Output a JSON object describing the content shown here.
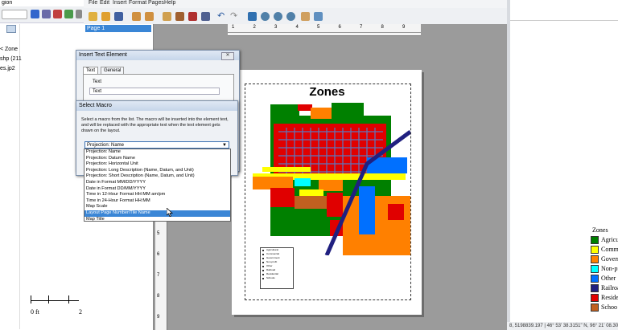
{
  "menu": [
    "File",
    "Edit",
    "Insert",
    "Format",
    "Pages",
    "Help"
  ],
  "left_partial": {
    "top_text": "gion",
    "tree": [
      "< Zone",
      "shp (211",
      "es.jp2"
    ],
    "scale": [
      "0 ft",
      "2"
    ]
  },
  "pages": {
    "items": [
      "Page 1"
    ]
  },
  "map": {
    "title": "Zones",
    "legend_items": [
      "Agricultural",
      "Commercial",
      "Government",
      "Non-profit",
      "Other",
      "Railroad",
      "Residential",
      "Schools"
    ]
  },
  "right_legend": {
    "title": "Zones",
    "items": [
      {
        "label": "Agricul",
        "color": "#008000"
      },
      {
        "label": "Comme",
        "color": "#ffff00"
      },
      {
        "label": "Govern",
        "color": "#ff8000"
      },
      {
        "label": "Non-pr",
        "color": "#00ffff"
      },
      {
        "label": "Other",
        "color": "#0070ff"
      },
      {
        "label": "Railroa",
        "color": "#202080"
      },
      {
        "label": "Reside",
        "color": "#e00000"
      },
      {
        "label": "Schoo",
        "color": "#c06020"
      }
    ]
  },
  "status": {
    "text": "8, 5198839.197 | 46° 53' 38.3151\" N, 96° 21' 08.30"
  },
  "insert_dialog": {
    "title": "Insert Text Element",
    "tabs": [
      "Text",
      "General"
    ],
    "text_label": "Text",
    "text_value": "Text"
  },
  "macro_dialog": {
    "title": "Select Macro",
    "description": "Select a macro from the list.  The macro will be inserted into the element text, and will be replaced with the appropriate text when the text element gets drawn on the layout.",
    "selected": "Projection: Name",
    "options": [
      "Projection: Name",
      "Projection: Datum Name",
      "Projection: Horizontal Unit",
      "Projection: Long Description (Name, Datum, and Unit)",
      "Projection: Short Description (Name, Datum, and Unit)",
      "Date in Format MM/DD/YYYY",
      "Date in Format DD/MM/YYYY",
      "Time in 12-Hour Format HH:MM am/pm",
      "Time in 24-Hour Format HH:MM",
      "Map Scale",
      "Layout Page Number/Tile Name",
      "Map Title"
    ],
    "highlighted_index": 10
  },
  "ruler": {
    "top_ticks": [
      "1",
      "2",
      "3",
      "4",
      "5",
      "6",
      "7",
      "8",
      "9"
    ],
    "left_ticks": [
      "3",
      "4",
      "5",
      "6",
      "7",
      "8",
      "9"
    ]
  }
}
